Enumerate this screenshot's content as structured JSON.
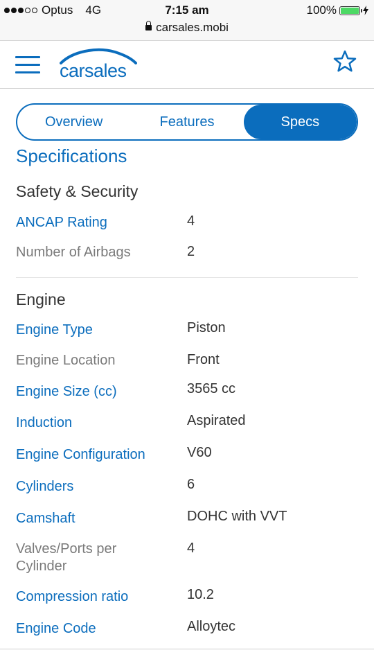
{
  "status_bar": {
    "carrier": "Optus",
    "network": "4G",
    "time": "7:15 am",
    "battery": "100%",
    "battery_level": 1.0,
    "url": "carsales.mobi"
  },
  "header": {
    "logo_text": "carsales",
    "brand_color": "#0b6dbd"
  },
  "tabs": [
    {
      "label": "Overview",
      "active": false
    },
    {
      "label": "Features",
      "active": false
    },
    {
      "label": "Specs",
      "active": true
    }
  ],
  "page_title": "Specifications",
  "sections": [
    {
      "heading": "Safety & Security",
      "rows": [
        {
          "label": "ANCAP Rating",
          "value": "4",
          "link": true
        },
        {
          "label": "Number of Airbags",
          "value": "2",
          "link": false
        }
      ]
    },
    {
      "heading": "Engine",
      "rows": [
        {
          "label": "Engine Type",
          "value": "Piston",
          "link": true
        },
        {
          "label": "Engine Location",
          "value": "Front",
          "link": false
        },
        {
          "label": "Engine Size (cc)",
          "value": "3565 cc",
          "link": true
        },
        {
          "label": "Induction",
          "value": "Aspirated",
          "link": true
        },
        {
          "label": "Engine Configuration",
          "value": "V60",
          "link": true
        },
        {
          "label": "Cylinders",
          "value": "6",
          "link": true
        },
        {
          "label": "Camshaft",
          "value": "DOHC with VVT",
          "link": true
        },
        {
          "label": "Valves/Ports per Cylinder",
          "value": "4",
          "link": false
        },
        {
          "label": "Compression ratio",
          "value": "10.2",
          "link": true
        },
        {
          "label": "Engine Code",
          "value": "Alloytec",
          "link": true
        }
      ]
    }
  ]
}
